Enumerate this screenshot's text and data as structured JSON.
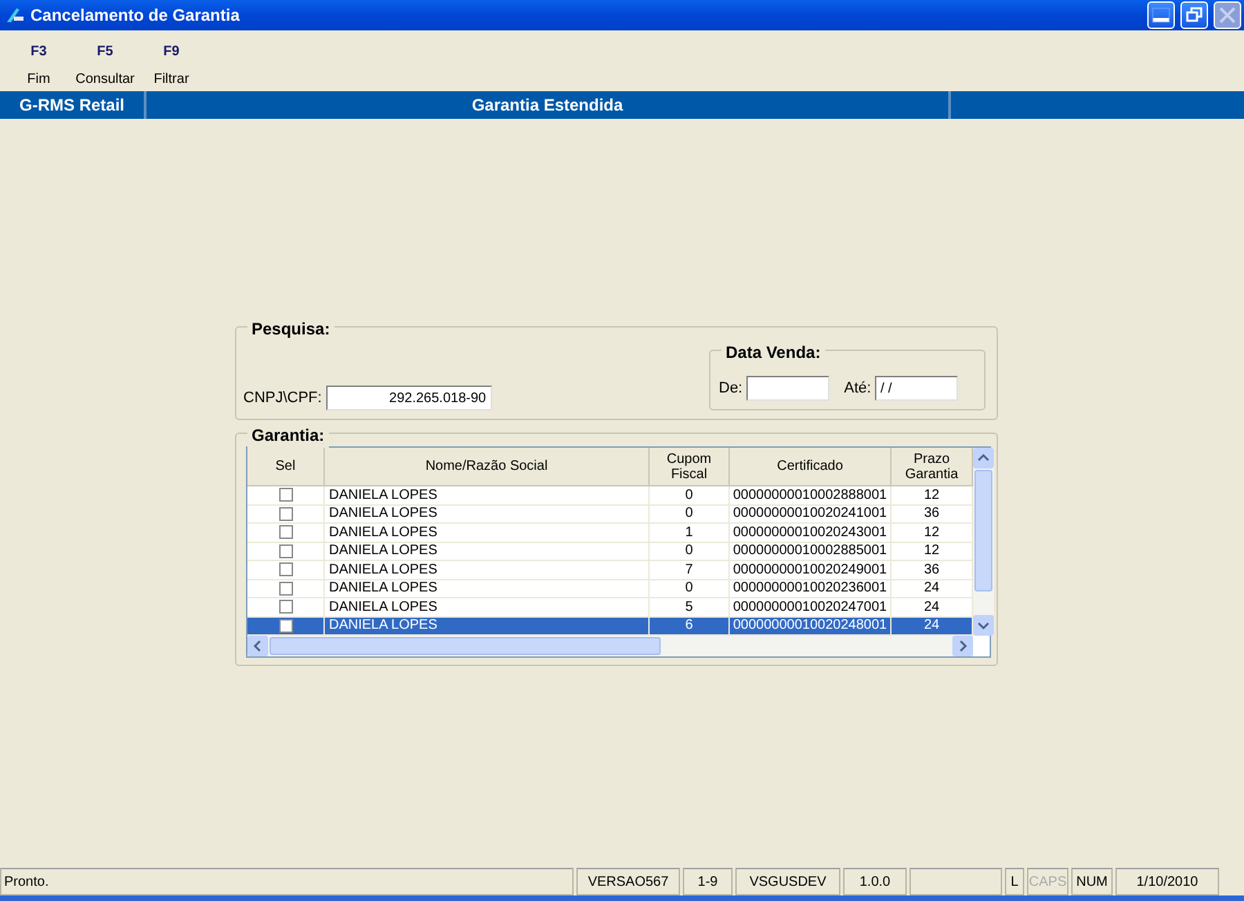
{
  "window": {
    "title": "Cancelamento de Garantia"
  },
  "toolbar": [
    {
      "key": "F3",
      "label": "Fim"
    },
    {
      "key": "F5",
      "label": "Consultar"
    },
    {
      "key": "F9",
      "label": "Filtrar"
    }
  ],
  "header_bar": {
    "app": "G-RMS Retail",
    "title": "Garantia Estendida"
  },
  "search": {
    "title": "Pesquisa:",
    "cpf_label": "CNPJ\\CPF:",
    "cpf_value": "292.265.018-90",
    "date_group": {
      "title": "Data Venda:",
      "from_label": "De:",
      "to_label": "Até:",
      "to_value": "/ /"
    }
  },
  "warranty": {
    "title": "Garantia:",
    "columns": [
      "Sel",
      "Nome/Razão Social",
      "Cupom Fiscal",
      "Certificado",
      "Prazo Garantia"
    ],
    "rows": [
      {
        "checked": false,
        "selected": false,
        "name": "DANIELA LOPES",
        "cupom": "0",
        "certificado": "00000000010002888001",
        "prazo": "12"
      },
      {
        "checked": false,
        "selected": false,
        "name": "DANIELA LOPES",
        "cupom": "0",
        "certificado": "00000000010020241001",
        "prazo": "36"
      },
      {
        "checked": false,
        "selected": false,
        "name": "DANIELA LOPES",
        "cupom": "1",
        "certificado": "00000000010020243001",
        "prazo": "12"
      },
      {
        "checked": false,
        "selected": false,
        "name": "DANIELA LOPES",
        "cupom": "0",
        "certificado": "00000000010002885001",
        "prazo": "12"
      },
      {
        "checked": false,
        "selected": false,
        "name": "DANIELA LOPES",
        "cupom": "7",
        "certificado": "00000000010020249001",
        "prazo": "36"
      },
      {
        "checked": false,
        "selected": false,
        "name": "DANIELA LOPES",
        "cupom": "0",
        "certificado": "00000000010020236001",
        "prazo": "24"
      },
      {
        "checked": false,
        "selected": false,
        "name": "DANIELA LOPES",
        "cupom": "5",
        "certificado": "00000000010020247001",
        "prazo": "24"
      },
      {
        "checked": false,
        "selected": true,
        "name": "DANIELA LOPES",
        "cupom": "6",
        "certificado": "00000000010020248001",
        "prazo": "24"
      }
    ]
  },
  "status_bar": [
    {
      "kind": "text",
      "text": "Pronto.",
      "disabled": false
    },
    {
      "kind": "text",
      "text": "VERSAO567",
      "disabled": false
    },
    {
      "kind": "text",
      "text": "1-9",
      "disabled": false
    },
    {
      "kind": "text",
      "text": "VSGUSDEV",
      "disabled": false
    },
    {
      "kind": "text",
      "text": "1.0.0",
      "disabled": false
    },
    {
      "kind": "blank"
    },
    {
      "kind": "text",
      "text": "L",
      "disabled": false
    },
    {
      "kind": "text",
      "text": "CAPS",
      "disabled": true
    },
    {
      "kind": "text",
      "text": "NUM",
      "disabled": false
    },
    {
      "kind": "text",
      "text": "1/10/2010",
      "disabled": false
    }
  ]
}
